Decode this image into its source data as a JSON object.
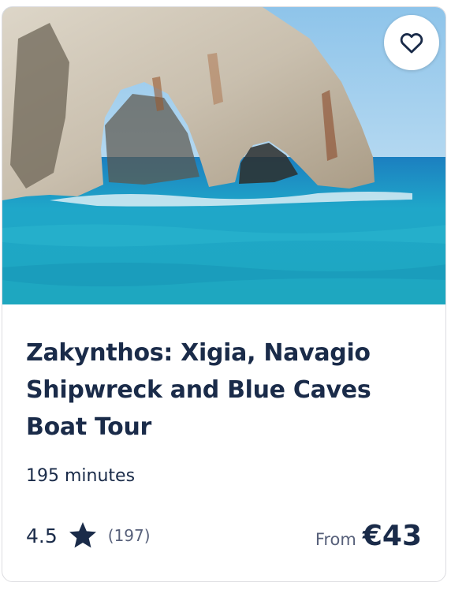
{
  "card": {
    "image": {
      "alt_icon": "sea-cave-photo"
    },
    "favorite": {
      "icon": "heart-icon"
    },
    "title": "Zakynthos: Xigia, Navagio Shipwreck and Blue Caves Boat Tour",
    "duration": "195 minutes",
    "rating": {
      "value": "4.5",
      "icon": "star-icon",
      "reviews": "(197)"
    },
    "price": {
      "prefix": "From",
      "amount": "€43"
    }
  },
  "colors": {
    "text_primary": "#1a2b49",
    "text_secondary": "#57607a",
    "card_border": "#dcdce0"
  }
}
